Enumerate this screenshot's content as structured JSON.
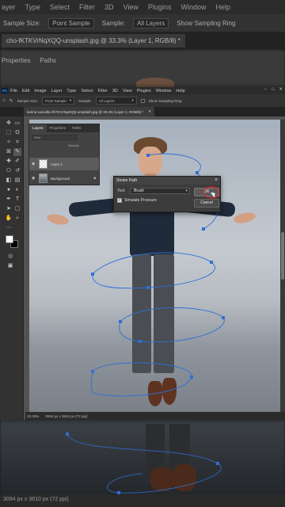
{
  "background": {
    "menu": [
      "ayer",
      "Type",
      "Select",
      "Filter",
      "3D",
      "View",
      "Plugins",
      "Window",
      "Help"
    ],
    "options": {
      "sample_size_label": "Sample Size:",
      "sample_size_value": "Point Sample",
      "sample_label": "Sample:",
      "sample_value": "All Layers",
      "sampling_ring_label": "Show Sampling Ring"
    },
    "doc_tab": "cho-fKTKVrNqXQQ-unsplash.jpg @ 33.3% (Layer 1, RGB/8) *",
    "panel_tabs": [
      "Properties",
      "Paths"
    ],
    "status": "3094 px x 3610 px (72 ppi)"
  },
  "app": {
    "logo": "Ps",
    "menu": [
      "File",
      "Edit",
      "Image",
      "Layer",
      "Type",
      "Select",
      "Filter",
      "3D",
      "View",
      "Plugins",
      "Window",
      "Help"
    ],
    "window_controls": [
      "–",
      "□",
      "✕"
    ],
    "options_bar": {
      "sample_size_label": "Sample Size:",
      "sample_size_value": "Point Sample",
      "sample_label": "Sample:",
      "sample_value": "All Layers",
      "sampling_ring_label": "Show Sampling Ring"
    },
    "document_tab": {
      "title": "karina-carvalho-fKTKVrNqXQQ-unsplash.jpg @ 33.3% (Layer 1, RGB/8) *",
      "close": "✕"
    },
    "status_bar": {
      "zoom": "33.33%",
      "info": "3094 px x 3610 px (72 ppi)"
    }
  },
  "layers_panel": {
    "tabs": [
      "Layers",
      "Properties",
      "Paths"
    ],
    "search_placeholder": "Kind",
    "opacity_label": "Opacity:",
    "fill_label": "Fill:",
    "layers": [
      {
        "name": "Layer 1",
        "selected": true
      },
      {
        "name": "Background",
        "locked": true
      }
    ]
  },
  "dialog": {
    "title": "Stroke Path",
    "tool_label": "Tool:",
    "tool_value": "Brush",
    "simulate_pressure_label": "Simulate Pressure",
    "simulate_pressure_checked": true,
    "ok_label": "OK",
    "cancel_label": "Cancel"
  },
  "colors": {
    "accent": "#31a8ff",
    "path_stroke": "#2f6fd6",
    "highlight_ring": "#e03030"
  }
}
